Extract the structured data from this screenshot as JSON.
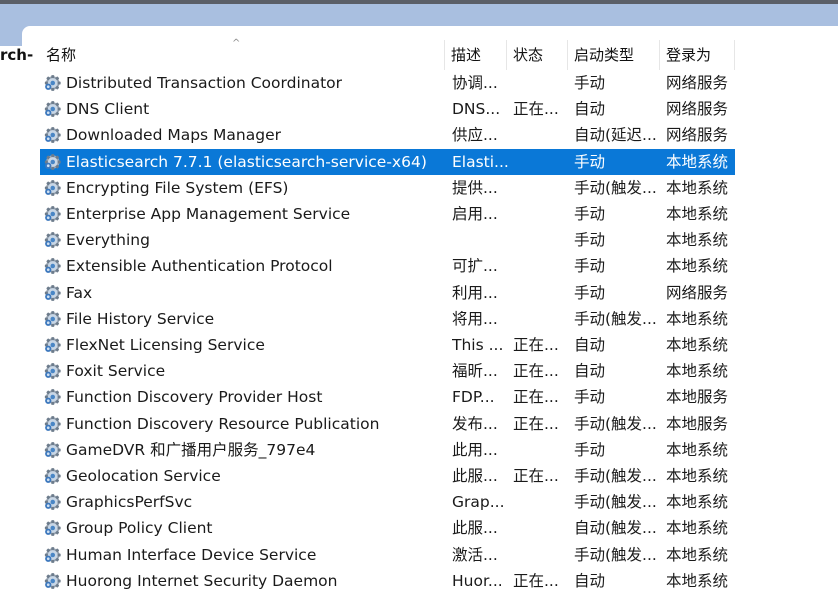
{
  "left_panel": {
    "label": "rch-"
  },
  "columns": {
    "name": "名称",
    "desc": "描述",
    "status": "状态",
    "startup": "启动类型",
    "logon": "登录为"
  },
  "sort_indicator": "^",
  "icon": "service-gear-icon",
  "selected_index": 3,
  "colors": {
    "selection": "#0a78d7",
    "title_bar": "#a9bfe0"
  },
  "services": [
    {
      "name": "Distributed Transaction Coordinator",
      "desc": "协调...",
      "status": "",
      "startup": "手动",
      "logon": "网络服务"
    },
    {
      "name": "DNS Client",
      "desc": "DNS...",
      "status": "正在...",
      "startup": "自动",
      "logon": "网络服务"
    },
    {
      "name": "Downloaded Maps Manager",
      "desc": "供应...",
      "status": "",
      "startup": "自动(延迟...",
      "logon": "网络服务"
    },
    {
      "name": "Elasticsearch 7.7.1 (elasticsearch-service-x64)",
      "desc": "Elasti...",
      "status": "",
      "startup": "手动",
      "logon": "本地系统"
    },
    {
      "name": "Encrypting File System (EFS)",
      "desc": "提供...",
      "status": "",
      "startup": "手动(触发...",
      "logon": "本地系统"
    },
    {
      "name": "Enterprise App Management Service",
      "desc": "启用...",
      "status": "",
      "startup": "手动",
      "logon": "本地系统"
    },
    {
      "name": "Everything",
      "desc": "",
      "status": "",
      "startup": "手动",
      "logon": "本地系统"
    },
    {
      "name": "Extensible Authentication Protocol",
      "desc": "可扩...",
      "status": "",
      "startup": "手动",
      "logon": "本地系统"
    },
    {
      "name": "Fax",
      "desc": "利用...",
      "status": "",
      "startup": "手动",
      "logon": "网络服务"
    },
    {
      "name": "File History Service",
      "desc": "将用...",
      "status": "",
      "startup": "手动(触发...",
      "logon": "本地系统"
    },
    {
      "name": "FlexNet Licensing Service",
      "desc": "This ...",
      "status": "正在...",
      "startup": "自动",
      "logon": "本地系统"
    },
    {
      "name": "Foxit Service",
      "desc": "福昕...",
      "status": "正在...",
      "startup": "自动",
      "logon": "本地系统"
    },
    {
      "name": "Function Discovery Provider Host",
      "desc": "FDP...",
      "status": "正在...",
      "startup": "手动",
      "logon": "本地服务"
    },
    {
      "name": "Function Discovery Resource Publication",
      "desc": "发布...",
      "status": "正在...",
      "startup": "手动(触发...",
      "logon": "本地服务"
    },
    {
      "name": "GameDVR 和广播用户服务_797e4",
      "desc": "此用...",
      "status": "",
      "startup": "手动",
      "logon": "本地系统"
    },
    {
      "name": "Geolocation Service",
      "desc": "此服...",
      "status": "正在...",
      "startup": "手动(触发...",
      "logon": "本地系统"
    },
    {
      "name": "GraphicsPerfSvc",
      "desc": "Grap...",
      "status": "",
      "startup": "手动(触发...",
      "logon": "本地系统"
    },
    {
      "name": "Group Policy Client",
      "desc": "此服...",
      "status": "",
      "startup": "自动(触发...",
      "logon": "本地系统"
    },
    {
      "name": "Human Interface Device Service",
      "desc": "激活...",
      "status": "",
      "startup": "手动(触发...",
      "logon": "本地系统"
    },
    {
      "name": "Huorong Internet Security Daemon",
      "desc": "Huor...",
      "status": "正在...",
      "startup": "自动",
      "logon": "本地系统"
    }
  ]
}
